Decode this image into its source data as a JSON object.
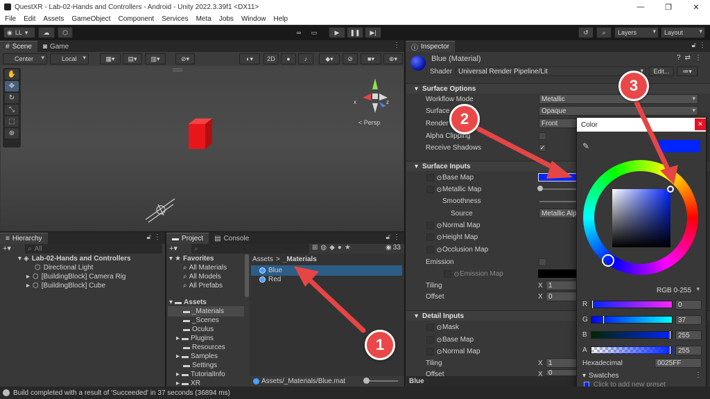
{
  "window": {
    "title": "QuestXR - Lab-02-Hands and Controllers - Android - Unity 2022.3.39f1 <DX11>",
    "minimize": "—",
    "maximize": "❐",
    "close": "✕"
  },
  "menu": [
    "File",
    "Edit",
    "Assets",
    "GameObject",
    "Component",
    "Services",
    "Meta",
    "Jobs",
    "Window",
    "Help"
  ],
  "toolbar": {
    "account": "LL",
    "layers": "Layers",
    "layout": "Layout"
  },
  "scene": {
    "tabs": [
      "Scene",
      "Game"
    ],
    "pivot": "Center",
    "space": "Local",
    "mode2d": "2D",
    "persp": "< Persp",
    "gizmo_x": "x",
    "gizmo_z": "z"
  },
  "hierarchy": {
    "tab": "Hierarchy",
    "search_placeholder": "All",
    "scene_name": "Lab-02-Hands and Controllers",
    "items": [
      "Directional Light",
      "[BuildingBlock] Camera Rig",
      "[BuildingBlock] Cube"
    ]
  },
  "project": {
    "tabs": [
      "Project",
      "Console"
    ],
    "count": "33",
    "favorites": "Favorites",
    "favorites_items": [
      "All Materials",
      "All Models",
      "All Prefabs"
    ],
    "assets": "Assets",
    "asset_folders": [
      "_Materials",
      "_Scenes",
      "Oculus",
      "Plugins",
      "Resources",
      "Samples",
      "Settings",
      "TutorialInfo",
      "XR"
    ],
    "breadcrumb_root": "Assets",
    "breadcrumb_sep": ">",
    "breadcrumb_leaf": "_Materials",
    "files": [
      "Blue",
      "Red"
    ],
    "path": "Assets/_Materials/Blue.mat"
  },
  "inspector": {
    "tab": "Inspector",
    "material_name": "Blue (Material)",
    "shader_label": "Shader",
    "shader_value": "Universal Render Pipeline/Lit",
    "edit_button": "Edit...",
    "surface_options": "Surface Options",
    "workflow_label": "Workflow Mode",
    "workflow_value": "Metallic",
    "surface_label": "Surface",
    "surface_value": "Opaque",
    "render_label": "Render",
    "render_value": "Front",
    "alpha_clip": "Alpha Clipping",
    "receive_shadows": "Receive Shadows",
    "surface_inputs": "Surface Inputs",
    "base_map": "Base Map",
    "metallic_map": "Metallic Map",
    "smoothness": "Smoothness",
    "source_label": "Source",
    "source_value": "Metallic Alp",
    "normal_map": "Normal Map",
    "height_map": "Height Map",
    "occlusion_map": "Occlusion Map",
    "emission": "Emission",
    "emission_map": "Emission Map",
    "tiling": "Tiling",
    "offset": "Offset",
    "axis_x": "X",
    "one": "1",
    "zero": "0",
    "detail_inputs": "Detail Inputs",
    "mask": "Mask",
    "detail_base_map": "Base Map",
    "detail_normal_map": "Normal Map",
    "tiling2": "Tiling",
    "offset2": "Offset",
    "footer": "Blue"
  },
  "color_picker": {
    "title": "Color",
    "mode": "RGB 0-255",
    "r_label": "R",
    "r_value": "0",
    "g_label": "G",
    "g_value": "37",
    "b_label": "B",
    "b_value": "255",
    "a_label": "A",
    "a_value": "255",
    "hex_label": "Hexadecimal",
    "hex_value": "0025FF",
    "swatches": "Swatches",
    "add_preset": "Click to add new preset",
    "current_color": "#0025FF"
  },
  "status": "Build completed with a result of 'Succeeded' in 37 seconds (36894 ms)",
  "annotations": [
    "1",
    "2",
    "3"
  ],
  "colors": {
    "accent_red": "#e64545",
    "cube": "#e8161b",
    "material": "#0025ff",
    "selection": "#2c5d87"
  }
}
